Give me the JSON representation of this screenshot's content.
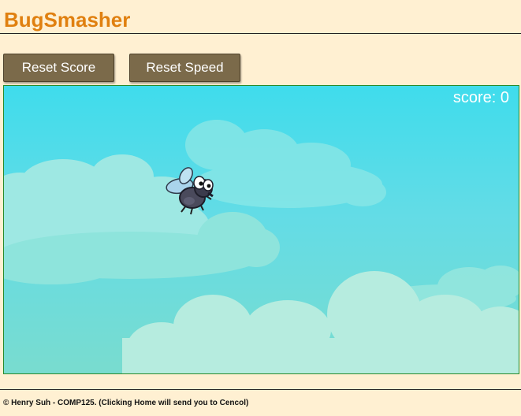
{
  "header": {
    "title": "BugSmasher"
  },
  "toolbar": {
    "reset_score_label": "Reset Score",
    "reset_speed_label": "Reset Speed"
  },
  "game": {
    "score_label": "score:",
    "score_value": "0",
    "bug_icon": "fly-bug-icon",
    "colors": {
      "sky_top": "#3fdcec",
      "sky_bottom": "#79dccf",
      "border": "#2a8a2a"
    }
  },
  "footer": {
    "text": "© Henry Suh - COMP125. (Clicking Home will send you to Cencol)"
  },
  "colors": {
    "page_bg": "#fff0d2",
    "title": "#e08010",
    "button_bg": "#7b6a4a"
  }
}
